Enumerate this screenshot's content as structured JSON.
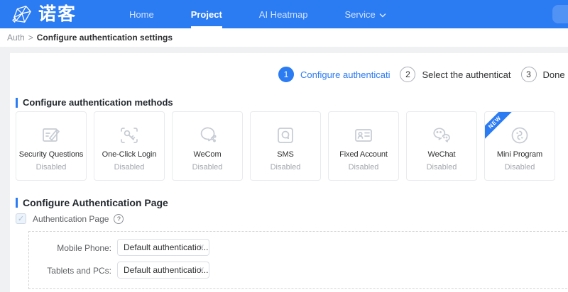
{
  "colors": {
    "accent": "#2b7bf3",
    "header_bg": "#2b7bf3",
    "page_bg": "#f0f1f3"
  },
  "header": {
    "logo_text": "诺客",
    "nav": [
      {
        "label": "Home"
      },
      {
        "label": "Project"
      },
      {
        "label": "AI Heatmap"
      },
      {
        "label": "Service"
      }
    ]
  },
  "breadcrumb": {
    "root": "Auth",
    "separator": ">",
    "current": "Configure authentication settings"
  },
  "steps": [
    {
      "number": "1",
      "label": "Configure authenticati"
    },
    {
      "number": "2",
      "label": "Select the authenticat"
    },
    {
      "number": "3",
      "label": "Done"
    }
  ],
  "methods_section": {
    "title": "Configure authentication methods",
    "items": [
      {
        "name": "Security Questions",
        "status": "Disabled",
        "icon": "security-questions-icon"
      },
      {
        "name": "One-Click Login",
        "status": "Disabled",
        "icon": "one-click-login-icon"
      },
      {
        "name": "WeCom",
        "status": "Disabled",
        "icon": "wecom-icon"
      },
      {
        "name": "SMS",
        "status": "Disabled",
        "icon": "sms-icon"
      },
      {
        "name": "Fixed Account",
        "status": "Disabled",
        "icon": "fixed-account-icon"
      },
      {
        "name": "WeChat",
        "status": "Disabled",
        "icon": "wechat-icon"
      },
      {
        "name": "Mini Program",
        "status": "Disabled",
        "icon": "mini-program-icon",
        "badge": "NEW"
      }
    ]
  },
  "page_section": {
    "title": "Configure Authentication Page",
    "checkbox_label": "Authentication Page",
    "help_glyph": "?",
    "checkbox_check": "✓",
    "fields": [
      {
        "label": "Mobile Phone:",
        "value": "Default authenticatio..."
      },
      {
        "label": "Tablets and PCs:",
        "value": "Default authenticatio..."
      }
    ]
  }
}
